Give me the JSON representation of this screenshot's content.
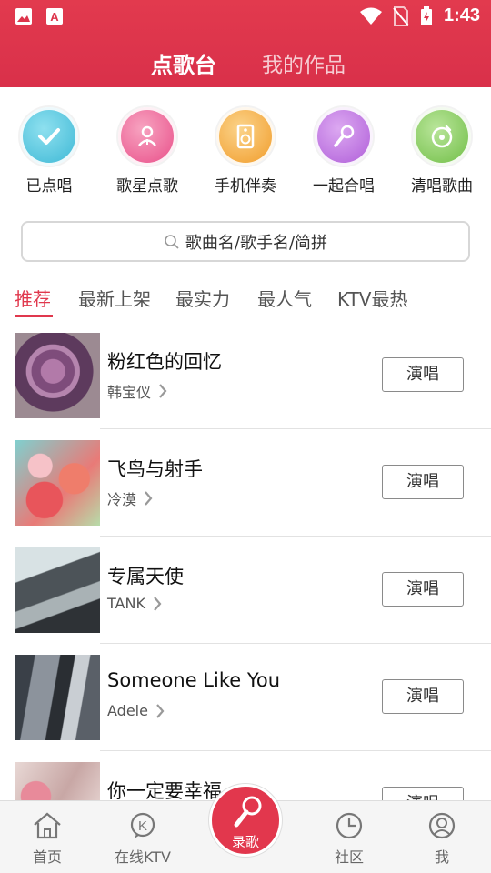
{
  "status_bar": {
    "time": "1:43"
  },
  "top_tabs": [
    {
      "label": "点歌台",
      "active": true
    },
    {
      "label": "我的作品",
      "active": false
    }
  ],
  "categories": [
    {
      "label": "已点唱",
      "icon": "check-icon",
      "color": "#5fc9df"
    },
    {
      "label": "歌星点歌",
      "icon": "singer-icon",
      "color": "#ef6d98"
    },
    {
      "label": "手机伴奏",
      "icon": "speaker-icon",
      "color": "#f6b34e"
    },
    {
      "label": "一起合唱",
      "icon": "microphone-icon",
      "color": "#c47be3"
    },
    {
      "label": "清唱歌曲",
      "icon": "vinyl-icon",
      "color": "#8fd06a"
    }
  ],
  "search": {
    "placeholder": "歌曲名/歌手名/简拼"
  },
  "sub_tabs": [
    {
      "label": "推荐",
      "active": true
    },
    {
      "label": "最新上架",
      "active": false
    },
    {
      "label": "最实力",
      "active": false
    },
    {
      "label": "最人气",
      "active": false
    },
    {
      "label": "KTV最热",
      "active": false
    }
  ],
  "songs": [
    {
      "title": "粉红色的回忆",
      "artist": "韩宝仪",
      "action": "演唱"
    },
    {
      "title": "飞鸟与射手",
      "artist": "冷漠",
      "action": "演唱"
    },
    {
      "title": "专属天使",
      "artist": "TANK",
      "action": "演唱"
    },
    {
      "title": "Someone Like You",
      "artist": "Adele",
      "action": "演唱"
    },
    {
      "title": "你一定要幸福",
      "artist": "",
      "action": "演唱"
    }
  ],
  "bottom_nav": [
    {
      "label": "首页",
      "icon": "home-icon"
    },
    {
      "label": "在线KTV",
      "icon": "ktv-icon"
    },
    {
      "label": "录歌",
      "icon": "microphone-icon"
    },
    {
      "label": "社区",
      "icon": "clock-icon"
    },
    {
      "label": "我",
      "icon": "profile-icon"
    }
  ],
  "colors": {
    "brand": "#e0384d",
    "header": "#dd344b",
    "nav_bg": "#f5f5f5"
  }
}
